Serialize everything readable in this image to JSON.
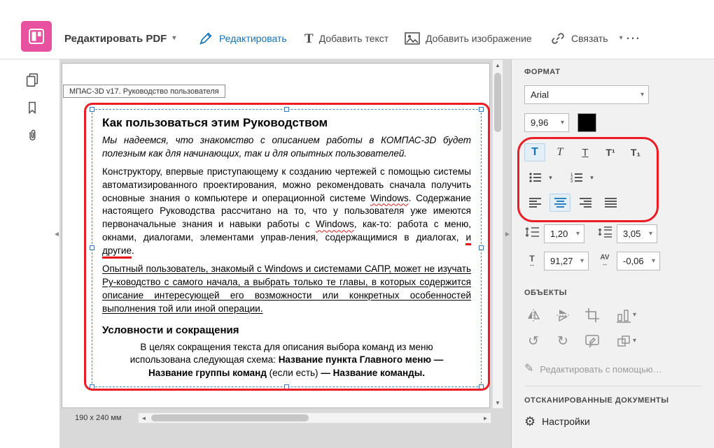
{
  "toolbar": {
    "edit_pdf": "Редактировать PDF",
    "edit": "Редактировать",
    "add_text": "Добавить текст",
    "add_image": "Добавить изображение",
    "link": "Связать",
    "more": "…"
  },
  "icons": {
    "chevron": "▾",
    "scroll_up": "▲",
    "scroll_down": "▼",
    "scroll_left": "◄",
    "scroll_right": "►",
    "collapse_left": "◄",
    "collapse_right": "►",
    "rotate_ccw": "↺",
    "rotate_cw": "↻",
    "pencil": "✎",
    "gear": "⚙",
    "text_tool": "T",
    "bold": "T",
    "italic": "T",
    "underline": "T",
    "superscript": "T¹",
    "subscript": "T₁",
    "hscale_t": "T",
    "kerning": "AV",
    "h_arrow": "↔"
  },
  "document": {
    "tab_label": "МПАС-3D v17. Руководство пользователя",
    "heading": "Как пользоваться этим Руководством",
    "intro": "Мы надеемся, что знакомство с описанием работы в КОМПАС-3D будет полезным как для начинающих, так и для опытных пользователей.",
    "p2": {
      "a": "Конструктору, впервые приступающему к созданию чертежей с помощью системы автоматизированного проектирования, можно рекомендовать сначала получить основные знания о компьютере и операционной системе ",
      "win1": "Windows",
      "b": ". Содержание настоящего Руководства рассчитано на то, что у пользователя уже имеются первоначальные знания и навыки работы с ",
      "win2": "Windows",
      "c": ", как-то: работа с меню, окнами, диалогами, элементами управ-ления, содержащимися в диалогах, ",
      "marked": "и другие",
      "d": "."
    },
    "p3": "Опытный пользователь, знакомый с Windows и системами САПР, может не изучать Ру-ководство с самого начала, а выбрать только те главы, в которых содержится описание интересующей его возможности или конкретных особенностей выполнения той или иной операции.",
    "heading2": "Условности и сокращения",
    "p4": {
      "a": "В целях сокращения текста для описания выбора команд из меню использована следующая схема: ",
      "b": "Название пункта Главного меню — Название группы команд",
      "c": " (если есть) ",
      "d": "— Название команды",
      "e": "."
    },
    "page_size": "190 x 240 мм"
  },
  "format": {
    "title": "ФОРМАТ",
    "font_family": "Arial",
    "font_size": "9,96",
    "line_spacing": "1,20",
    "paragraph_spacing": "3,05",
    "horizontal_scale": "91,27",
    "char_spacing": "-0,06",
    "objects_title": "ОБЪЕКТЫ",
    "edit_with": "Редактировать с помощью…",
    "scanned_title": "ОТСКАНИРОВАННЫЕ ДОКУМЕНТЫ",
    "settings": "Настройки"
  },
  "colors": {
    "accent_blue": "#1473ba",
    "annotation_red": "#ec1c24",
    "brand_pink": "#e7519f"
  }
}
